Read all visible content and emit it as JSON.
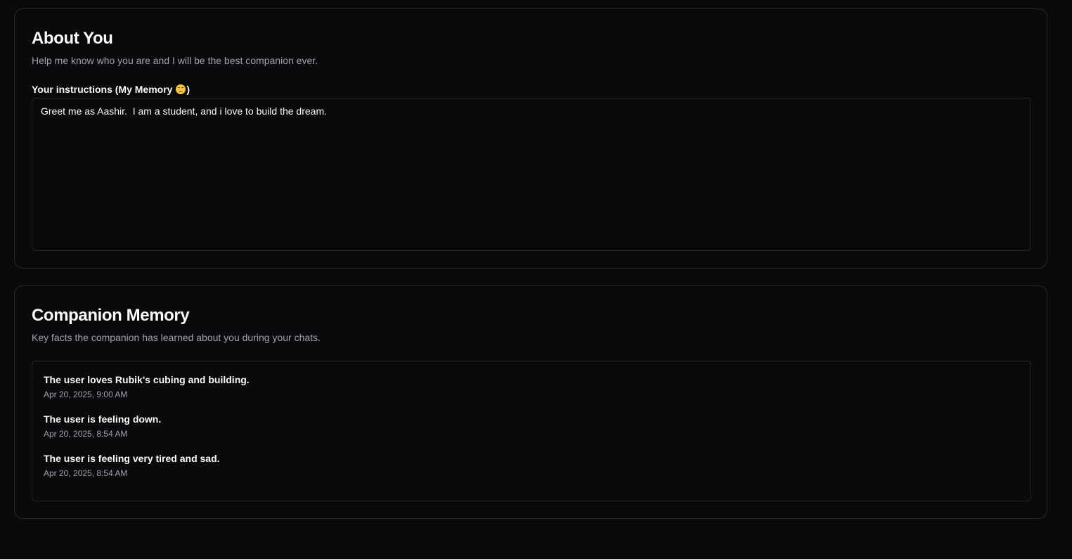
{
  "about": {
    "title": "About You",
    "description": "Help me know who you are and I will be the best companion ever.",
    "label_prefix": "Your instructions (My Memory ",
    "label_suffix": ")",
    "label_emoji": "smiling-face-icon",
    "instructions_value": "Greet me as Aashir.  I am a student, and i love to build the dream."
  },
  "memory": {
    "title": "Companion Memory",
    "description": "Key facts the companion has learned about you during your chats.",
    "items": [
      {
        "text": "The user loves Rubik's cubing and building.",
        "time": "Apr 20, 2025, 9:00 AM"
      },
      {
        "text": "The user is feeling down.",
        "time": "Apr 20, 2025, 8:54 AM"
      },
      {
        "text": "The user is feeling very tired and sad.",
        "time": "Apr 20, 2025, 8:54 AM"
      }
    ]
  },
  "colors": {
    "background": "#0a0a0c",
    "border": "#27272a",
    "text": "#fafafa",
    "muted": "#a1a1aa"
  }
}
